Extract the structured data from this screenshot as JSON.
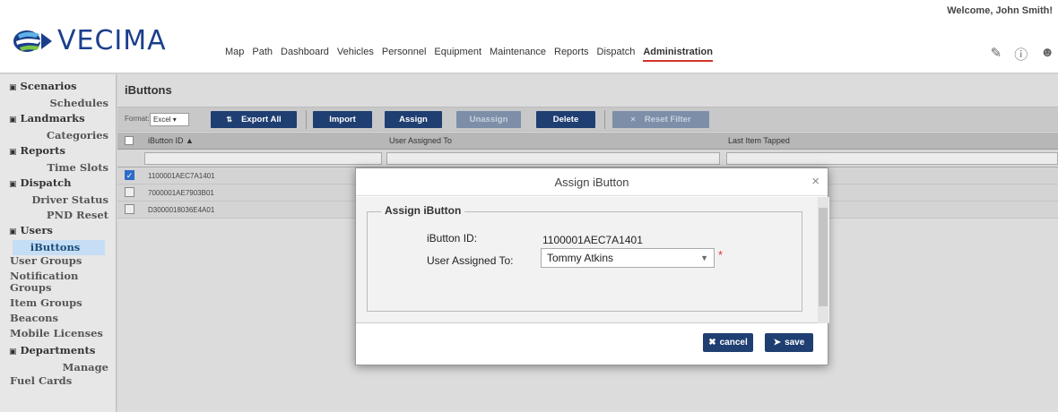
{
  "header": {
    "logo_text": "VECIMA",
    "welcome": "Welcome, John Smith!",
    "nav": [
      "Map",
      "Path",
      "Dashboard",
      "Vehicles",
      "Personnel",
      "Equipment",
      "Maintenance",
      "Reports",
      "Dispatch",
      "Administration"
    ],
    "active_nav": "Administration",
    "icons": [
      "message-icon",
      "help-icon",
      "user-icon"
    ]
  },
  "sidebar": {
    "items": [
      {
        "type": "header",
        "label": "Scenarios"
      },
      {
        "type": "sub",
        "label": "Schedules"
      },
      {
        "type": "header",
        "label": "Landmarks"
      },
      {
        "type": "sub",
        "label": "Categories"
      },
      {
        "type": "header",
        "label": "Reports"
      },
      {
        "type": "sub",
        "label": "Time Slots"
      },
      {
        "type": "header",
        "label": "Dispatch"
      },
      {
        "type": "sub",
        "label": "Driver Status"
      },
      {
        "type": "sub",
        "label": "PND Reset"
      },
      {
        "type": "header",
        "label": "Users"
      },
      {
        "type": "sub",
        "label": "iButtons",
        "selected": true
      },
      {
        "type": "left",
        "label": "User Groups"
      },
      {
        "type": "left",
        "label": "Notification Groups"
      },
      {
        "type": "left",
        "label": "Item Groups"
      },
      {
        "type": "left",
        "label": "Beacons"
      },
      {
        "type": "left",
        "label": "Mobile Licenses"
      },
      {
        "type": "header",
        "label": "Departments"
      },
      {
        "type": "sub",
        "label": "Manage"
      },
      {
        "type": "left",
        "label": "Fuel Cards"
      }
    ]
  },
  "main": {
    "title": "iButtons",
    "format_label": "Format:",
    "format_value": "Excel",
    "buttons": {
      "export_all": "Export All",
      "import": "Import",
      "assign": "Assign",
      "unassign": "Unassign",
      "delete": "Delete",
      "reset_filter": "Reset Filter"
    },
    "columns": [
      "iButton ID",
      "User Assigned To",
      "Last Item Tapped"
    ],
    "rows": [
      {
        "id": "1100001AEC7A1401",
        "checked": true
      },
      {
        "id": "7000001AE7903B01",
        "checked": false
      },
      {
        "id": "D3000018036E4A01",
        "checked": false
      }
    ]
  },
  "modal": {
    "title": "Assign iButton",
    "legend": "Assign iButton",
    "ibutton_label": "iButton ID:",
    "ibutton_value": "1100001AEC7A1401",
    "user_label": "User Assigned To:",
    "user_value": "Tommy Atkins",
    "required_mark": "*",
    "cancel": "cancel",
    "save": "save"
  }
}
